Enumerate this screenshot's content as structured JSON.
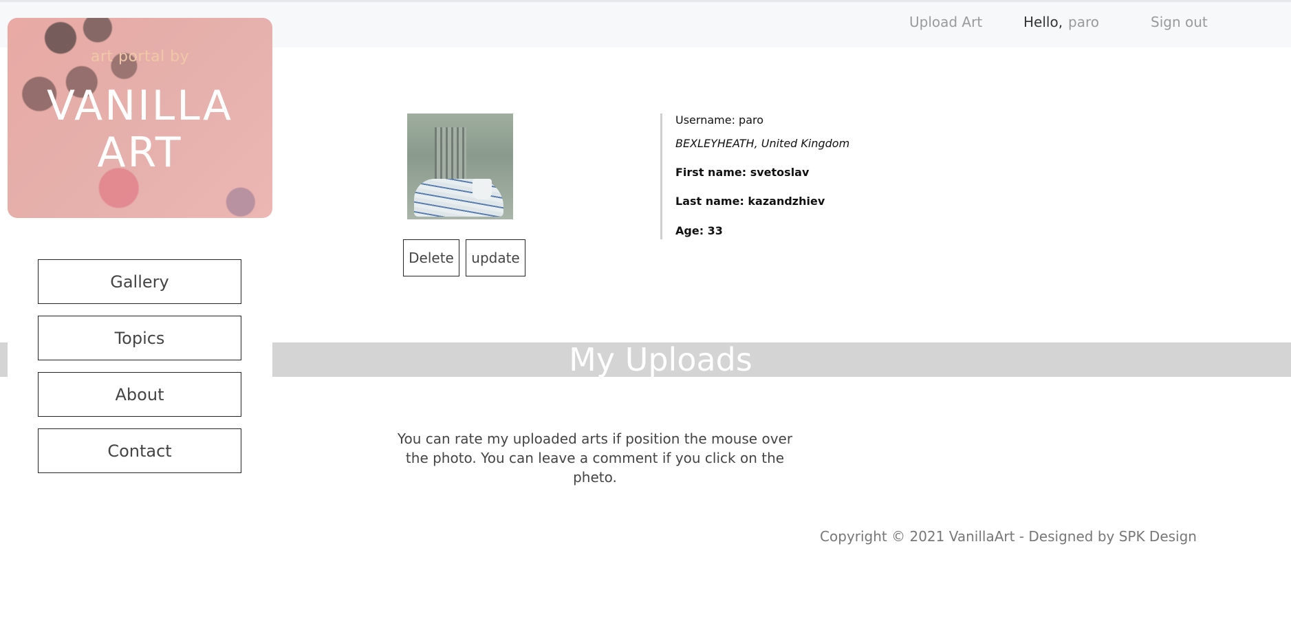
{
  "topbar": {
    "upload_label": "Upload Art",
    "hello_label": "Hello,",
    "username": "paro",
    "signout_label": "Sign out"
  },
  "logo": {
    "subtitle": "art portal by",
    "title_line1": "VANILLA",
    "title_line2": "ART"
  },
  "sidebar": {
    "items": [
      {
        "label": "Gallery"
      },
      {
        "label": "Topics"
      },
      {
        "label": "About"
      },
      {
        "label": "Contact"
      }
    ]
  },
  "profile": {
    "delete_label": "Delete",
    "update_label": "update",
    "username_line": "Username: paro",
    "location": "BEXLEYHEATH, United Kingdom",
    "first_name_line": "First name: svetoslav",
    "last_name_line": "Last name: kazandzhiev",
    "age_line": "Age: 33"
  },
  "uploads": {
    "title": "My Uploads",
    "note": "You can rate my uploaded arts if position the mouse over the photo. You can leave a comment if you click on the pheto."
  },
  "footer": {
    "copyright": "Copyright © 2021 VanillaArt - Designed by SPK Design"
  }
}
